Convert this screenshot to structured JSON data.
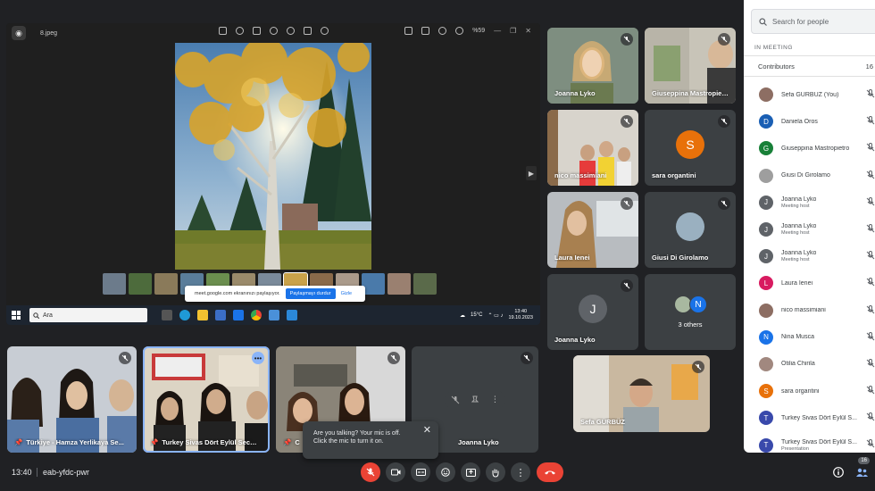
{
  "presentation": {
    "file_name": "8.jpeg",
    "zoom": "%59",
    "share_message": "meet.google.com ekranınızı paylaşıyor.",
    "share_stop": "Paylaşmayı durdur",
    "share_hide": "Gizle",
    "search_placeholder": "Ara",
    "weather": "15°C",
    "clock_time": "13:40",
    "clock_date": "19.10.2023"
  },
  "tiles": [
    {
      "name": "Joanna Lyko"
    },
    {
      "name": "Giuseppina Mastropietro"
    },
    {
      "name": "nico massimiani"
    },
    {
      "name": "sara organtini",
      "initial": "S",
      "color": "#e8710a"
    },
    {
      "name": "Laura Ienei"
    },
    {
      "name": "Giusi Di Girolamo"
    },
    {
      "name": "Joanna Lyko",
      "initial": "J",
      "color": "#5f6368"
    },
    {
      "name": "3 others",
      "initial": "N",
      "color": "#1a73e8"
    },
    {
      "name": "Sefa GÜRBÜZ"
    },
    {
      "name": "Türkiye - Hamza Yerlikaya Se..."
    },
    {
      "name": "Turkey Sivas Dört Eylül Seco..."
    },
    {
      "name": "C"
    },
    {
      "name": "Joanna Lyko"
    }
  ],
  "tooltip": {
    "text": "Are you talking? Your mic is off. Click the mic to turn it on."
  },
  "bottom_bar": {
    "time": "13:40",
    "meeting_code": "eab-yfdc-pwr",
    "people_count": "16"
  },
  "panel": {
    "search_placeholder": "Search for people",
    "section_label": "IN MEETING",
    "contributors_label": "Contributors",
    "contributors_count": "16",
    "participants": [
      {
        "name": "Sefa GÜRBÜZ (You)",
        "sub": "",
        "initial": "",
        "color": "#8d6e63"
      },
      {
        "name": "Daniela Oros",
        "sub": "",
        "initial": "D",
        "color": "#1a5fb4"
      },
      {
        "name": "Giuseppina Mastropietro",
        "sub": "",
        "initial": "G",
        "color": "#188038"
      },
      {
        "name": "Giusi Di Girolamo",
        "sub": "",
        "initial": "",
        "color": "#9e9e9e"
      },
      {
        "name": "Joanna Lyko",
        "sub": "Meeting host",
        "initial": "J",
        "color": "#5f6368"
      },
      {
        "name": "Joanna Lyko",
        "sub": "Meeting host",
        "initial": "J",
        "color": "#5f6368"
      },
      {
        "name": "Joanna Lyko",
        "sub": "Meeting host",
        "initial": "J",
        "color": "#5f6368"
      },
      {
        "name": "Laura Ienei",
        "sub": "",
        "initial": "L",
        "color": "#d81b60"
      },
      {
        "name": "nico massimiani",
        "sub": "",
        "initial": "",
        "color": "#8d6e63"
      },
      {
        "name": "Nina Musca",
        "sub": "",
        "initial": "N",
        "color": "#1a73e8"
      },
      {
        "name": "Otilia Chirila",
        "sub": "",
        "initial": "",
        "color": "#a1887f"
      },
      {
        "name": "sara organtini",
        "sub": "",
        "initial": "S",
        "color": "#e8710a"
      },
      {
        "name": "Turkey Sivas Dört Eylül S...",
        "sub": "",
        "initial": "T",
        "color": "#3949ab"
      },
      {
        "name": "Turkey Sivas Dört Eylül S...",
        "sub": "Presentation",
        "initial": "T",
        "color": "#3949ab"
      }
    ]
  },
  "colors": {
    "accent": "#8ab4f8",
    "danger": "#ea4335",
    "tile_bg": "#3c4043"
  },
  "icons": [
    "search-icon",
    "mic-off-icon",
    "camera-icon",
    "captions-icon",
    "emoji-icon",
    "present-icon",
    "raise-hand-icon",
    "more-options-icon",
    "end-call-icon",
    "info-icon",
    "people-icon",
    "close-icon",
    "pin-icon"
  ]
}
